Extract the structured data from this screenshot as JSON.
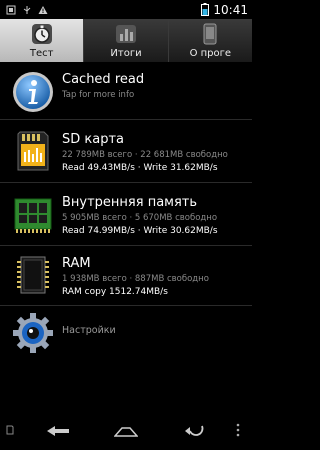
{
  "status_bar": {
    "time": "10:41",
    "icons": [
      "sim-icon",
      "usb-icon",
      "warning-icon",
      "battery-icon"
    ]
  },
  "tabs": [
    {
      "label": "Тест",
      "icon": "stopwatch-icon",
      "active": true
    },
    {
      "label": "Итоги",
      "icon": "bar-chart-icon",
      "active": false
    },
    {
      "label": "О проге",
      "icon": "phone-icon",
      "active": false
    }
  ],
  "list": {
    "cached": {
      "title": "Cached read",
      "subtitle": "Tap for more info",
      "icon": "info-icon"
    },
    "sd": {
      "title": "SD карта",
      "sizes": "22 789MB всего · 22 681MB свободно",
      "speed": "Read 49.43MB/s · Write 31.62MB/s",
      "icon": "sd-card-icon"
    },
    "internal": {
      "title": "Внутренняя память",
      "sizes": "5 905MB всего · 5 670MB свободно",
      "speed": "Read 74.99MB/s · Write 30.62MB/s",
      "icon": "memory-module-icon"
    },
    "ram": {
      "title": "RAM",
      "sizes": "1 938MB всего · 887MB свободно",
      "speed": "RAM copy 1512.74MB/s",
      "icon": "chip-icon"
    },
    "settings": {
      "title": "Настройки",
      "icon": "gear-icon"
    }
  },
  "nav": [
    "back-icon",
    "home-icon",
    "recents-icon"
  ]
}
